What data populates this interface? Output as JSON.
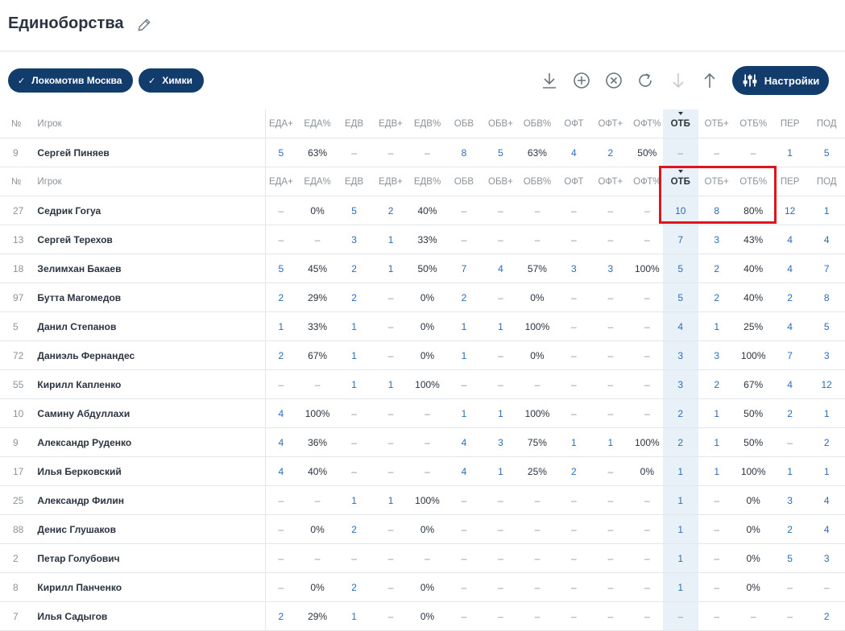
{
  "page_title": "Единоборства",
  "filters": [
    "Локомотив Москва",
    "Химки"
  ],
  "settings_label": "Настройки",
  "columns": [
    "№",
    "Игрок",
    "ЕДА+",
    "ЕДА%",
    "ЕДВ",
    "ЕДВ+",
    "ЕДВ%",
    "ОБВ",
    "ОБВ+",
    "ОБВ%",
    "ОФТ",
    "ОФТ+",
    "ОФТ%",
    "ОТБ",
    "ОТБ+",
    "ОТБ%",
    "ПЕР",
    "ПОД"
  ],
  "sorted_column": "ОТБ",
  "pinned_row": [
    "9",
    "Сергей Пиняев",
    "5",
    "63%",
    "–",
    "–",
    "–",
    "8",
    "5",
    "63%",
    "4",
    "2",
    "50%",
    "–",
    "–",
    "–",
    "1",
    "5"
  ],
  "rows": [
    [
      "27",
      "Седрик Гогуа",
      "–",
      "0%",
      "5",
      "2",
      "40%",
      "–",
      "–",
      "–",
      "–",
      "–",
      "–",
      "10",
      "8",
      "80%",
      "12",
      "1"
    ],
    [
      "13",
      "Сергей Терехов",
      "–",
      "–",
      "3",
      "1",
      "33%",
      "–",
      "–",
      "–",
      "–",
      "–",
      "–",
      "7",
      "3",
      "43%",
      "4",
      "4"
    ],
    [
      "18",
      "Зелимхан Бакаев",
      "5",
      "45%",
      "2",
      "1",
      "50%",
      "7",
      "4",
      "57%",
      "3",
      "3",
      "100%",
      "5",
      "2",
      "40%",
      "4",
      "7"
    ],
    [
      "97",
      "Бутта Магомедов",
      "2",
      "29%",
      "2",
      "–",
      "0%",
      "2",
      "–",
      "0%",
      "–",
      "–",
      "–",
      "5",
      "2",
      "40%",
      "2",
      "8"
    ],
    [
      "5",
      "Данил Степанов",
      "1",
      "33%",
      "1",
      "–",
      "0%",
      "1",
      "1",
      "100%",
      "–",
      "–",
      "–",
      "4",
      "1",
      "25%",
      "4",
      "5"
    ],
    [
      "72",
      "Даниэль Фернандес",
      "2",
      "67%",
      "1",
      "–",
      "0%",
      "1",
      "–",
      "0%",
      "–",
      "–",
      "–",
      "3",
      "3",
      "100%",
      "7",
      "3"
    ],
    [
      "55",
      "Кирилл Капленко",
      "–",
      "–",
      "1",
      "1",
      "100%",
      "–",
      "–",
      "–",
      "–",
      "–",
      "–",
      "3",
      "2",
      "67%",
      "4",
      "12"
    ],
    [
      "10",
      "Самину Абдуллахи",
      "4",
      "100%",
      "–",
      "–",
      "–",
      "1",
      "1",
      "100%",
      "–",
      "–",
      "–",
      "2",
      "1",
      "50%",
      "2",
      "1"
    ],
    [
      "9",
      "Александр Руденко",
      "4",
      "36%",
      "–",
      "–",
      "–",
      "4",
      "3",
      "75%",
      "1",
      "1",
      "100%",
      "2",
      "1",
      "50%",
      "–",
      "2"
    ],
    [
      "17",
      "Илья Берковский",
      "4",
      "40%",
      "–",
      "–",
      "–",
      "4",
      "1",
      "25%",
      "2",
      "–",
      "0%",
      "1",
      "1",
      "100%",
      "1",
      "1"
    ],
    [
      "25",
      "Александр Филин",
      "–",
      "–",
      "1",
      "1",
      "100%",
      "–",
      "–",
      "–",
      "–",
      "–",
      "–",
      "1",
      "–",
      "0%",
      "3",
      "4"
    ],
    [
      "88",
      "Денис Глушаков",
      "–",
      "0%",
      "2",
      "–",
      "0%",
      "–",
      "–",
      "–",
      "–",
      "–",
      "–",
      "1",
      "–",
      "0%",
      "2",
      "4"
    ],
    [
      "2",
      "Петар Голубович",
      "–",
      "–",
      "–",
      "–",
      "–",
      "–",
      "–",
      "–",
      "–",
      "–",
      "–",
      "1",
      "–",
      "0%",
      "5",
      "3"
    ],
    [
      "8",
      "Кирилл Панченко",
      "–",
      "0%",
      "2",
      "–",
      "0%",
      "–",
      "–",
      "–",
      "–",
      "–",
      "–",
      "1",
      "–",
      "0%",
      "–",
      "–"
    ],
    [
      "7",
      "Илья Садыгов",
      "2",
      "29%",
      "1",
      "–",
      "0%",
      "–",
      "–",
      "–",
      "–",
      "–",
      "–",
      "–",
      "–",
      "–",
      "–",
      "2"
    ]
  ]
}
